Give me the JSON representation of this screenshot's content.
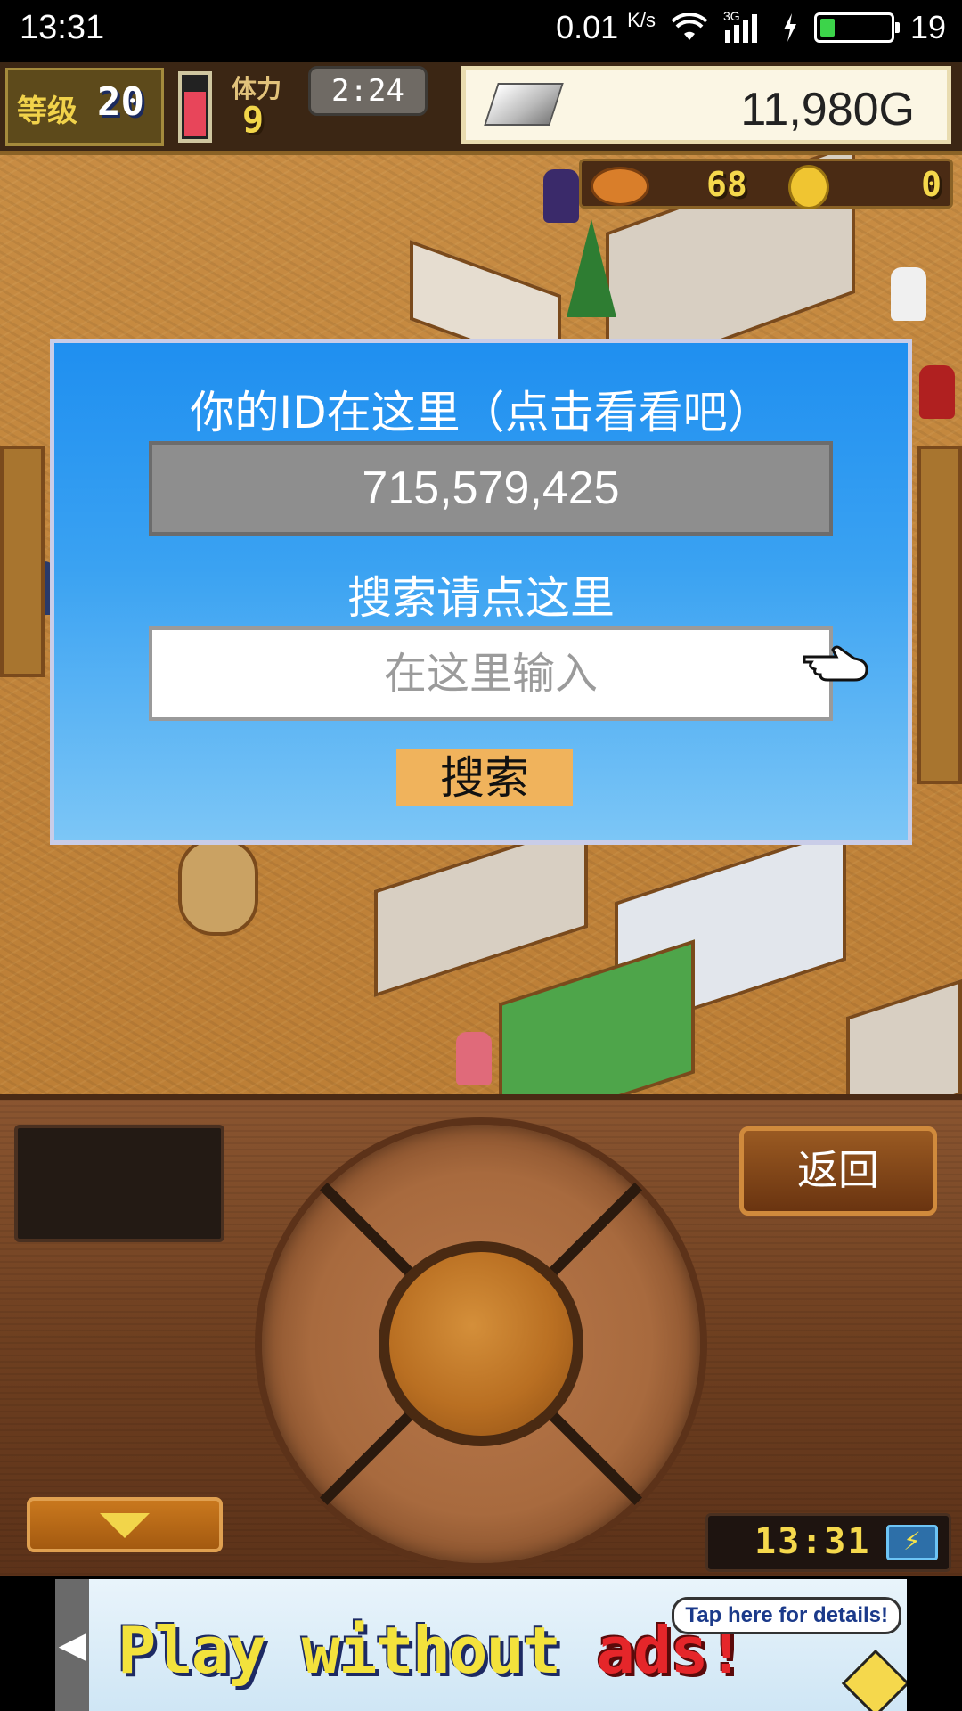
{
  "status_bar": {
    "time": "13:31",
    "net_speed": "0.01",
    "net_unit": "K/s",
    "net_type": "3G",
    "battery_level": "19",
    "battery_fraction": 0.19
  },
  "hud": {
    "level_label": "等级",
    "level_value": "20",
    "stamina_label": "体力",
    "stamina_value": "9",
    "stamina_fraction": 0.7,
    "clock": "2:24",
    "money": "11,980G",
    "food_count": "68",
    "coin_count": "0"
  },
  "dialog": {
    "title": "你的ID在这里（点击看看吧）",
    "player_id": "715,579,425",
    "search_label": "搜索请点这里",
    "search_placeholder": "在这里输入",
    "search_button": "搜索"
  },
  "panel": {
    "back_button": "返回",
    "clock": "13:31",
    "battery_icon": "lightning-icon"
  },
  "ad": {
    "text_main": "Play without",
    "text_highlight": "ads!",
    "bubble": "Tap here for details!",
    "arrow_icon": "chevron-left-icon"
  },
  "colors": {
    "dialog_blue": "#1f8ff0",
    "search_button": "#f0b35c",
    "money_panel": "#fbf6e4"
  }
}
